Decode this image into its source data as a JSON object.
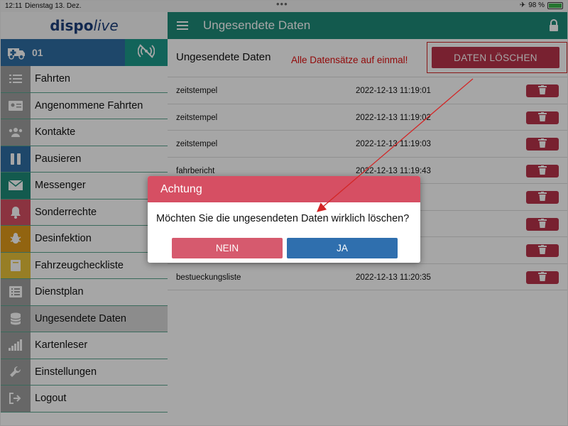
{
  "statusbar": {
    "time": "12:11",
    "date": "Dienstag 13. Dez.",
    "battery": "98 %",
    "battery_level": 0.98
  },
  "logo": {
    "part1": "dispo",
    "part2": "live"
  },
  "vehicle": {
    "number": "01"
  },
  "sidebar": {
    "items": [
      {
        "label": "Fahrten",
        "icon": "list-icon",
        "color": "#9e9e9e"
      },
      {
        "label": "Angenommene Fahrten",
        "icon": "id-card-icon",
        "color": "#9e9e9e"
      },
      {
        "label": "Kontakte",
        "icon": "users-icon",
        "color": "#9e9e9e"
      },
      {
        "label": "Pausieren",
        "icon": "pause-icon",
        "color": "#2e6da4"
      },
      {
        "label": "Messenger",
        "icon": "envelope-icon",
        "color": "#1e8a78"
      },
      {
        "label": "Sonderrechte",
        "icon": "bell-icon",
        "color": "#d64f63"
      },
      {
        "label": "Desinfektion",
        "icon": "bug-icon",
        "color": "#e09a1a"
      },
      {
        "label": "Fahrzeugcheckliste",
        "icon": "book-icon",
        "color": "#e8c23a"
      },
      {
        "label": "Dienstplan",
        "icon": "list-alt-icon",
        "color": "#9e9e9e"
      },
      {
        "label": "Ungesendete Daten",
        "icon": "database-icon",
        "color": "#9e9e9e",
        "active": true
      },
      {
        "label": "Kartenleser",
        "icon": "signal-bars-icon",
        "color": "#9e9e9e"
      },
      {
        "label": "Einstellungen",
        "icon": "wrench-icon",
        "color": "#9e9e9e"
      },
      {
        "label": "Logout",
        "icon": "logout-icon",
        "color": "#9e9e9e"
      }
    ]
  },
  "header": {
    "title": "Ungesendete Daten"
  },
  "main": {
    "subtitle": "Ungesendete Daten",
    "annotation": "Alle Datensätze auf einmal!",
    "delete_all_label": "DATEN LÖSCHEN",
    "rows": [
      {
        "name": "zeitstempel",
        "timestamp": "2022-12-13 11:19:01"
      },
      {
        "name": "zeitstempel",
        "timestamp": "2022-12-13 11:19:02"
      },
      {
        "name": "zeitstempel",
        "timestamp": "2022-12-13 11:19:03"
      },
      {
        "name": "fahrbericht",
        "timestamp": "2022-12-13 11:19:43"
      },
      {
        "name": "",
        "timestamp": ":47"
      },
      {
        "name": "",
        "timestamp": ":48"
      },
      {
        "name": "",
        "timestamp": ":04"
      },
      {
        "name": "bestueckungsliste",
        "timestamp": "2022-12-13 11:20:35"
      }
    ]
  },
  "dialog": {
    "title": "Achtung",
    "message": "Möchten Sie die ungesendeten Daten wirklich löschen?",
    "no_label": "NEIN",
    "yes_label": "JA"
  },
  "colors": {
    "teal": "#1e8a78",
    "blue": "#2e6da4",
    "red": "#b8334a",
    "dialog_header": "#d64f63"
  }
}
